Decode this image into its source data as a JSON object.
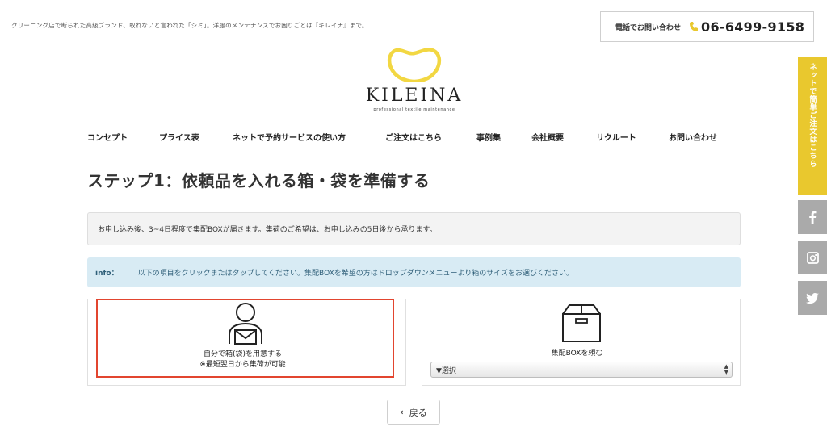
{
  "header": {
    "tagline": "クリーニング店で断られた高級ブランド、取れないと言われた「シミ」。洋服のメンテナンスでお困りごとは『キレイナ』まで。",
    "phone_label": "電話でお問い合わせ",
    "phone_number": "06-6499-9158",
    "logo_text": "KILEINA",
    "logo_sub": "professional textile maintenance"
  },
  "nav": {
    "items": [
      "コンセプト",
      "プライス表",
      "ネットで予約サービスの使い方",
      "ご注文はこちら",
      "事例集",
      "会社概要",
      "リクルート",
      "お問い合わせ"
    ]
  },
  "main": {
    "title": "ステップ1：依頼品を入れる箱・袋を準備する",
    "notice": "お申し込み後、3~4日程度で集配BOXが届きます。集荷のご希望は、お申し込みの5日後から承ります。",
    "info_label": "info：",
    "info_text": "以下の項目をクリックまたはタップしてください。集配BOXを希望の方はドロップダウンメニューより箱のサイズをお選びください。",
    "options": [
      {
        "line1": "自分で箱(袋)を用意する",
        "line2": "※最短翌日から集荷が可能",
        "icon": "person-envelope-icon"
      },
      {
        "line1": "集配BOXを頼む",
        "icon": "box-icon",
        "select_value": "▼選択"
      }
    ],
    "back_label": "戻る"
  },
  "side": {
    "order_label": "ネットで簡単ご注文はこちら",
    "social": [
      "facebook-icon",
      "instagram-icon",
      "twitter-icon"
    ]
  },
  "colors": {
    "accent_yellow": "#e9c82e",
    "selected_border": "#e2452f",
    "info_bg": "#d8ebf4",
    "side_gray": "#aaaaaa"
  }
}
